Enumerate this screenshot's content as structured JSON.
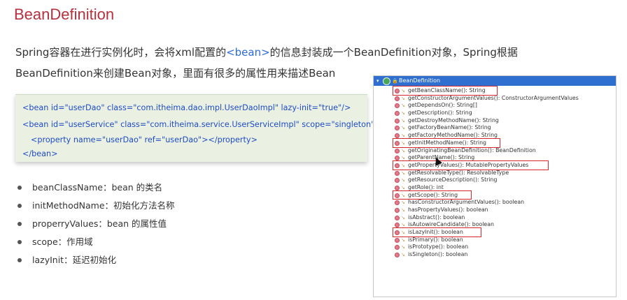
{
  "title": "BeanDefinition",
  "intro": {
    "line1_prefix": "Spring容器在进行实例化时，会将xml配置的",
    "line1_highlight": "<bean>",
    "line1_suffix": "的信息封装成一个BeanDefinition对象，Spring根据",
    "line2": "BeanDefinition来创建Bean对象，里面有很多的属性用来描述Bean"
  },
  "code": {
    "line1": {
      "open": "<bean ",
      "id_attr": "id=",
      "id_val": "\"userDao\"",
      "class_attr": " class=",
      "class_val": "\"com.itheima.dao.impl.UserDaoImpl\"",
      "lazy_attr": " lazy-init=",
      "lazy_val": "\"true\"",
      "close": "/>"
    },
    "line2": {
      "open": "<bean ",
      "id_attr": "id=",
      "id_val": "\"userService\"",
      "class_attr": " class=",
      "class_val": "\"com.itheima.service.UserServiceImpl\"",
      "scope_attr": " scope=",
      "scope_val": "\"singleton\"",
      "close": ">"
    },
    "line3": {
      "open": "<property ",
      "name_attr": "name=",
      "name_val": "\"userDao\"",
      "ref_attr": " ref=",
      "ref_val": "\"userDao\"",
      "close": "></property>"
    },
    "line4": "</bean>"
  },
  "bullets": [
    "beanClassName：bean 的类名",
    "initMethodName：初始化方法名称",
    "properryValues：bean 的属性值",
    "scope：作用域",
    "lazyInit：延迟初始化"
  ],
  "ide": {
    "header_arrow": "▾",
    "header_lock": "🔒",
    "header_title": "BeanDefinition",
    "methods": [
      "getBeanClassName(): String",
      "getConstructorArgumentValues(): ConstructorArgumentValues",
      "getDependsOn(): String[]",
      "getDescription(): String",
      "getDestroyMethodName(): String",
      "getFactoryBeanName(): String",
      "getFactoryMethodName(): String",
      "getInitMethodName(): String",
      "getOriginatingBeanDefinition(): BeanDefinition",
      "getParentName(): String",
      "getPropertyValues(): MutablePropertyValues",
      "getResolvableType(): ResolvableType",
      "getResourceDescription(): String",
      "getRole(): int",
      "getScope(): String",
      "hasConstructorArgumentValues(): boolean",
      "hasPropertyValues(): boolean",
      "isAbstract(): boolean",
      "isAutowireCandidate(): boolean",
      "isLazyInit(): boolean",
      "isPrimary(): boolean",
      "isPrototype(): boolean",
      "isSingleton(): boolean"
    ],
    "highlighted_methods": [
      "getBeanClassName(): String",
      "getInitMethodName(): String",
      "getPropertyValues(): MutablePropertyValues",
      "getScope(): String",
      "isLazyInit(): boolean"
    ]
  },
  "colors": {
    "title": "#b6303d",
    "highlight": "#2c6bd6",
    "code_bg": "#eaf1e2",
    "ide_header": "#2f6fd0",
    "annotation_box": "#d82630"
  }
}
